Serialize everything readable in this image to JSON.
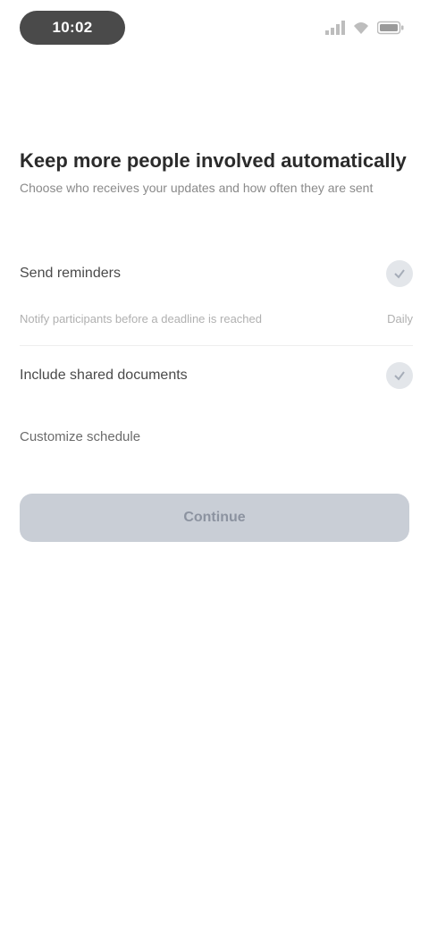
{
  "status_bar": {
    "time": "10:02"
  },
  "header": {
    "title": "Keep more people involved automatically",
    "subtitle": "Choose who receives your updates and how often they are sent"
  },
  "options": [
    {
      "label": "Send reminders",
      "desc": "Notify participants before a deadline is reached",
      "value": "Daily"
    },
    {
      "label": "Include shared documents",
      "desc": "",
      "value": ""
    }
  ],
  "link": {
    "label": "Customize schedule"
  },
  "primary_button": {
    "label": "Continue"
  }
}
